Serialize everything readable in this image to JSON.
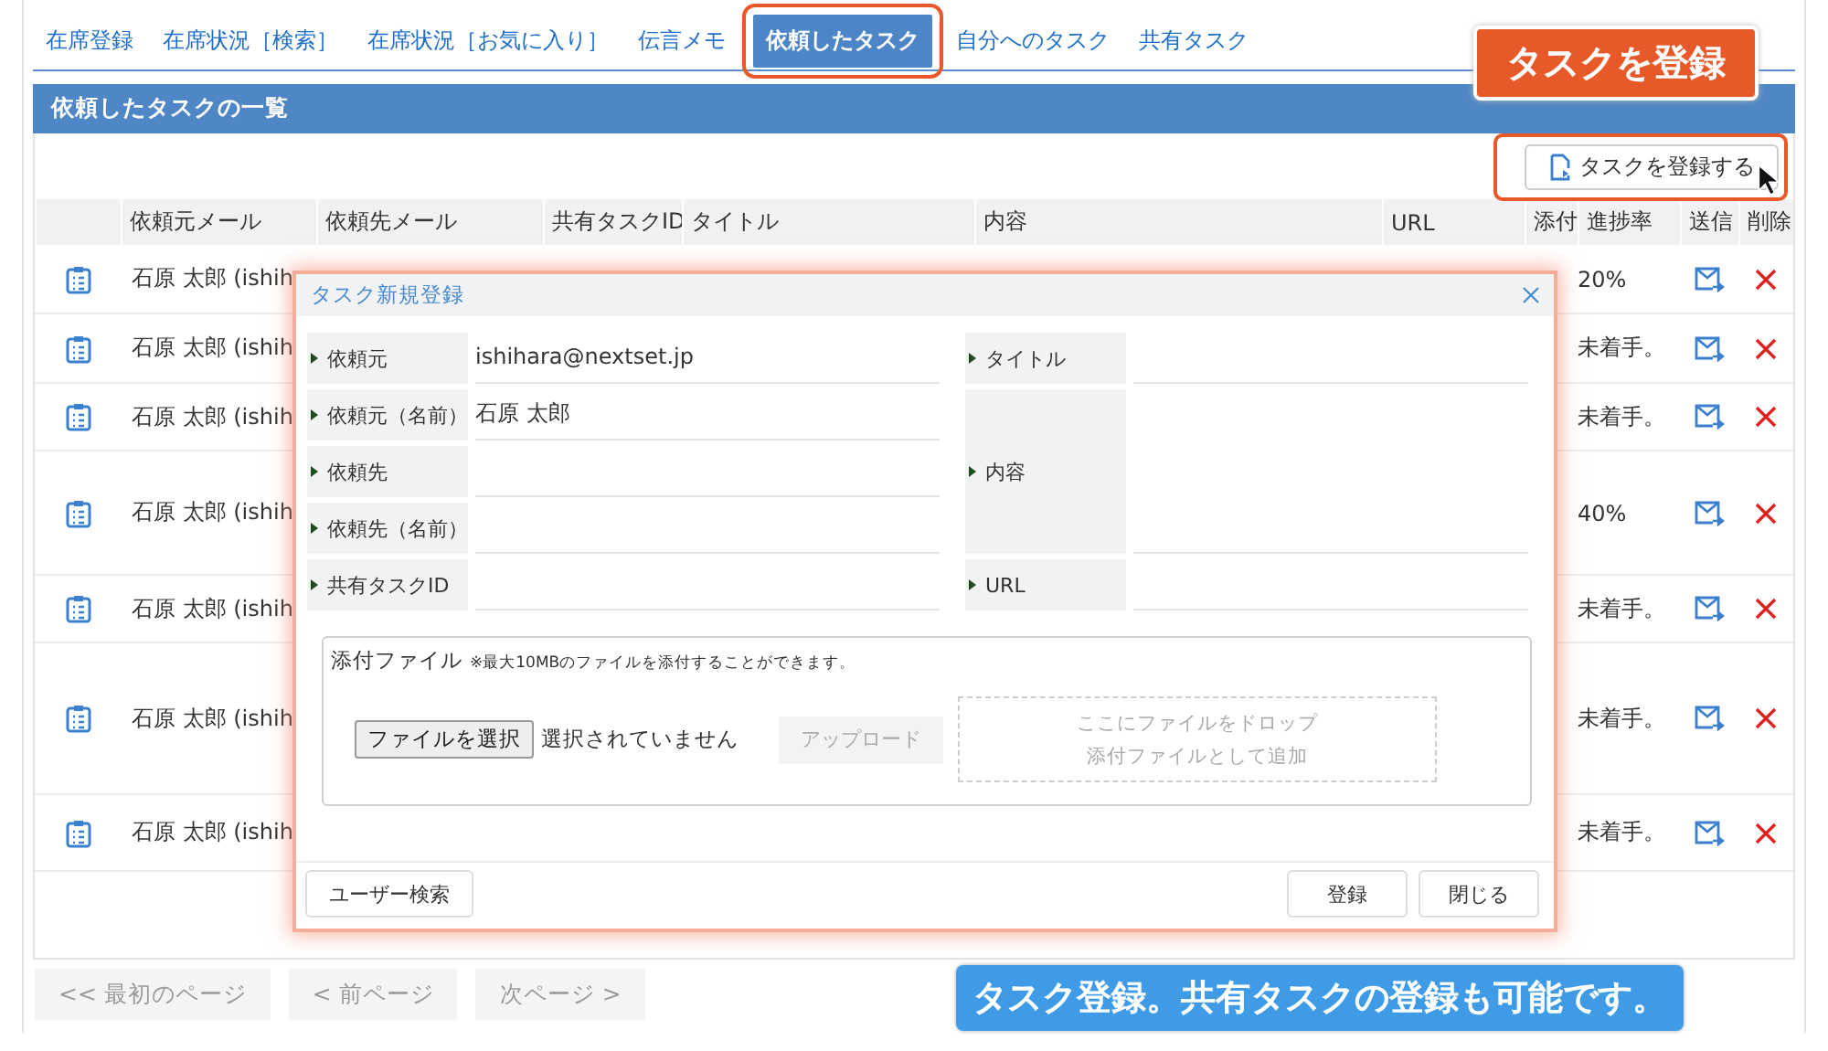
{
  "tabs": [
    {
      "label": "在席登録",
      "selected": false
    },
    {
      "label": "在席状況［検索］",
      "selected": false
    },
    {
      "label": "在席状況［お気に入り］",
      "selected": false
    },
    {
      "label": "伝言メモ",
      "selected": false
    },
    {
      "label": "依頼したタスク",
      "selected": true
    },
    {
      "label": "自分へのタスク",
      "selected": false
    },
    {
      "label": "共有タスク",
      "selected": false
    }
  ],
  "panel": {
    "title": "依頼したタスクの一覧",
    "register_button": "タスクを登録する"
  },
  "table": {
    "columns": [
      "依頼元メール",
      "依頼先メール",
      "共有タスクID",
      "タイトル",
      "内容",
      "URL",
      "添付",
      "進捗率",
      "送信",
      "削除"
    ],
    "rows": [
      {
        "requester": "石原 太郎 (ishih",
        "progress": "20%"
      },
      {
        "requester": "石原 太郎 (ishih",
        "progress": "未着手。"
      },
      {
        "requester": "石原 太郎 (ishih",
        "progress": "未着手。"
      },
      {
        "requester": "石原 太郎 (ishih",
        "progress": "40%"
      },
      {
        "requester": "石原 太郎 (ishih",
        "progress": "未着手。"
      },
      {
        "requester": "石原 太郎 (ishih",
        "progress": "未着手。"
      },
      {
        "requester": "石原 太郎 (ishih",
        "progress": "未着手。"
      }
    ]
  },
  "pager": [
    {
      "label": "<< 最初のページ",
      "disabled": true
    },
    {
      "label": "< 前ページ",
      "disabled": true
    },
    {
      "label": "次ページ >",
      "disabled": true
    }
  ],
  "modal": {
    "title": "タスク新規登録",
    "fields_left": [
      {
        "label": "依頼元",
        "value": "ishihara@nextset.jp"
      },
      {
        "label": "依頼元（名前）",
        "value": "石原 太郎"
      },
      {
        "label": "依頼先"
      },
      {
        "label": "依頼先（名前）"
      },
      {
        "label": "共有タスクID"
      }
    ],
    "fields_right": [
      {
        "label": "タイトル",
        "kind": "line"
      },
      {
        "label": "内容",
        "kind": "multiline"
      },
      {
        "label": "URL",
        "kind": "line"
      }
    ],
    "attachment": {
      "label": "添付ファイル",
      "note": "※最大10MBのファイルを添付することができます。",
      "choose_button": "ファイルを選択",
      "file_status": "選択されていません",
      "upload_button": {
        "label": "アップロード",
        "disabled": true
      },
      "drop_zone": [
        "ここにファイルをドロップ",
        "添付ファイルとして追加"
      ]
    },
    "footer_buttons": [
      {
        "label": "ユーザー検索",
        "kind": "left"
      },
      {
        "label": "登録",
        "kind": "right"
      },
      {
        "label": "閉じる",
        "kind": "right"
      }
    ]
  },
  "annotations": {
    "badge": "タスクを登録",
    "caption": "タスク登録。共有タスクの登録も可能です。"
  }
}
